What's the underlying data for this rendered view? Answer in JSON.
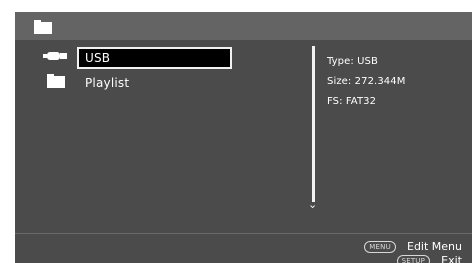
{
  "header": {
    "folder_icon": "folder-icon"
  },
  "file_list": {
    "items": [
      {
        "label": "USB",
        "icon": "usb-drive-icon",
        "selected": true
      },
      {
        "label": "Playlist",
        "icon": "folder-icon",
        "selected": false
      }
    ]
  },
  "info": {
    "type": "Type: USB",
    "size": "Size: 272.344M",
    "fs": "FS: FAT32"
  },
  "footer": {
    "menu_key": "MENU",
    "menu_label": "Edit Menu",
    "setup_key": "SETUP",
    "setup_label": "Exit"
  },
  "colors": {
    "background": "#4b4b4b",
    "header_bar": "#646464",
    "selection_fill": "#000000",
    "text": "#ffffff"
  }
}
